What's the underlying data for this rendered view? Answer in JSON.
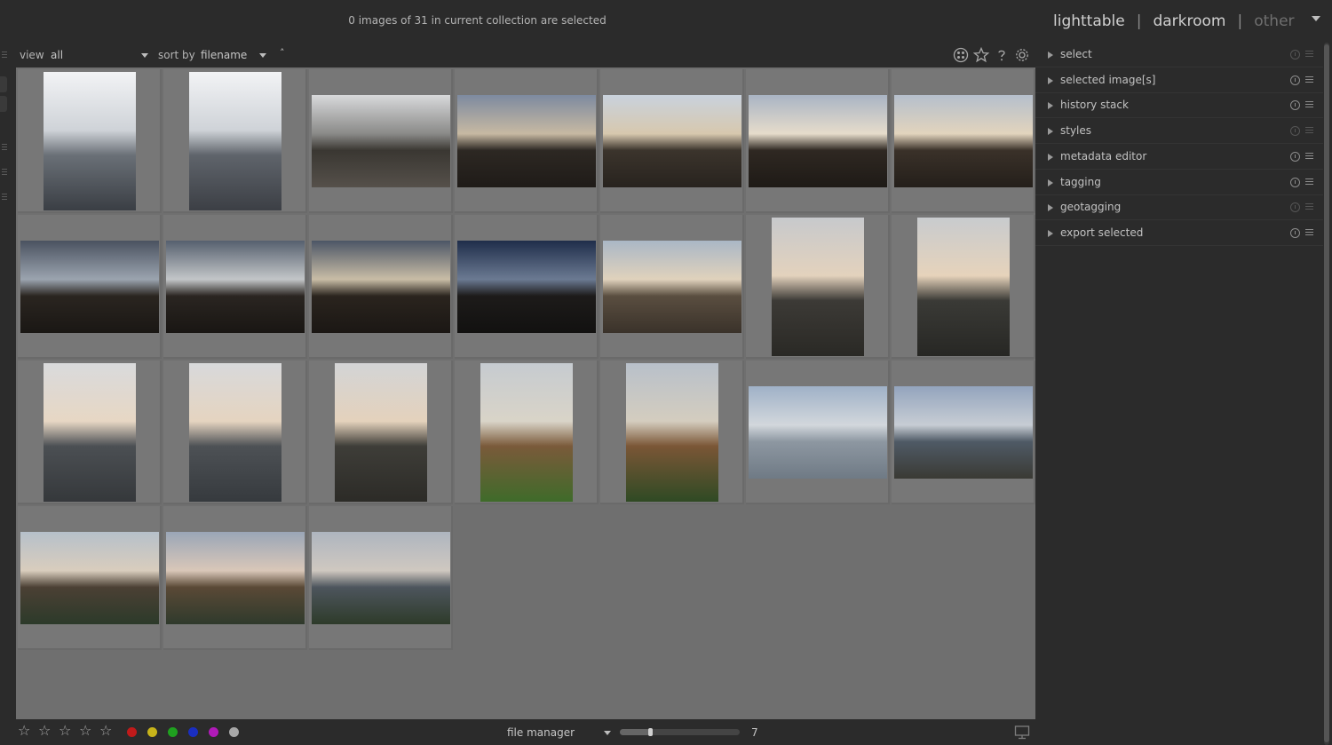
{
  "header": {
    "status": "0 images of 31 in current collection are selected",
    "views": [
      {
        "label": "lighttable",
        "active": true
      },
      {
        "label": "darkroom",
        "active": false
      },
      {
        "label": "other",
        "active": false
      }
    ]
  },
  "toolbar": {
    "view_label": "view",
    "view_value": "all",
    "sort_label": "sort by",
    "sort_value": "filename",
    "sort_order_glyph": "˄",
    "icons": [
      "grouping-icon",
      "star-overlay-icon",
      "help-icon",
      "preferences-gear-icon"
    ]
  },
  "grid": {
    "columns": 7,
    "thumbs_per_row": 7,
    "images": [
      {
        "orient": "portrait",
        "colors": [
          "#f2f3f5",
          "#cfd3d8",
          "#6a7077",
          "#3a3e44"
        ]
      },
      {
        "orient": "portrait",
        "colors": [
          "#f2f3f5",
          "#cfd3d8",
          "#5f646b",
          "#3c3f45"
        ]
      },
      {
        "orient": "landscape",
        "colors": [
          "#d8d9db",
          "#8a8a88",
          "#3a3732",
          "#55504a"
        ]
      },
      {
        "orient": "landscape",
        "colors": [
          "#7d8aa0",
          "#c7b9a2",
          "#2d2823",
          "#1f1b18"
        ]
      },
      {
        "orient": "landscape",
        "colors": [
          "#c9d2dd",
          "#d7c8ae",
          "#3b342c",
          "#28231e"
        ]
      },
      {
        "orient": "landscape",
        "colors": [
          "#a9b4c4",
          "#e6dccb",
          "#2f2822",
          "#1e1a16"
        ]
      },
      {
        "orient": "landscape",
        "colors": [
          "#b5bfcc",
          "#e2d4bd",
          "#3a3129",
          "#241f1a"
        ]
      },
      {
        "orient": "landscape",
        "colors": [
          "#4a5260",
          "#9ba4af",
          "#2a2520",
          "#1a1714"
        ]
      },
      {
        "orient": "landscape",
        "colors": [
          "#56606f",
          "#c3c6c8",
          "#2a2521",
          "#191613"
        ]
      },
      {
        "orient": "landscape",
        "colors": [
          "#4c5666",
          "#c9bda6",
          "#2a241e",
          "#1b1714"
        ]
      },
      {
        "orient": "landscape",
        "colors": [
          "#1f2d4a",
          "#6b7a92",
          "#1d1b1a",
          "#121110"
        ]
      },
      {
        "orient": "landscape",
        "colors": [
          "#aab7c6",
          "#e0d2bc",
          "#5a4e40",
          "#3a322a"
        ]
      },
      {
        "orient": "portrait",
        "colors": [
          "#c7c9cc",
          "#e3d2bd",
          "#3c3a36",
          "#2a2925"
        ]
      },
      {
        "orient": "portrait",
        "colors": [
          "#c8cbce",
          "#e6d3bb",
          "#3a3a36",
          "#272724"
        ]
      },
      {
        "orient": "portrait",
        "colors": [
          "#d9dadc",
          "#e7d7c4",
          "#4b4f53",
          "#35383b"
        ]
      },
      {
        "orient": "portrait",
        "colors": [
          "#d8d9db",
          "#e5d4c0",
          "#4d5155",
          "#363a3e"
        ]
      },
      {
        "orient": "portrait",
        "colors": [
          "#d3d4d6",
          "#e4d2bc",
          "#3e3d38",
          "#2c2b27"
        ]
      },
      {
        "orient": "portrait",
        "colors": [
          "#c6cbd0",
          "#d9d4c8",
          "#7a5a3a",
          "#3f6b2a"
        ]
      },
      {
        "orient": "portrait",
        "colors": [
          "#b8c0ca",
          "#d4cdbf",
          "#7a5636",
          "#2f4a24"
        ]
      },
      {
        "orient": "landscape",
        "colors": [
          "#9fb1c7",
          "#d2d7dc",
          "#8d97a1",
          "#6f7a85"
        ]
      },
      {
        "orient": "landscape",
        "colors": [
          "#93a4bd",
          "#c7cdd4",
          "#4f5a66",
          "#3a3a34"
        ]
      },
      {
        "orient": "landscape",
        "colors": [
          "#b6c0ca",
          "#d9cdbd",
          "#4b4034",
          "#2c3a2a"
        ]
      },
      {
        "orient": "landscape",
        "colors": [
          "#9aa6b7",
          "#d9c7b8",
          "#5a4936",
          "#2f3a2c"
        ]
      },
      {
        "orient": "landscape",
        "colors": [
          "#aeb5bf",
          "#cfc8c0",
          "#4d555d",
          "#2e3b2a"
        ]
      }
    ]
  },
  "modules": [
    {
      "label": "select",
      "active": false
    },
    {
      "label": "selected image[s]",
      "active": true
    },
    {
      "label": "history stack",
      "active": true
    },
    {
      "label": "styles",
      "active": false
    },
    {
      "label": "metadata editor",
      "active": true
    },
    {
      "label": "tagging",
      "active": true
    },
    {
      "label": "geotagging",
      "active": false
    },
    {
      "label": "export selected",
      "active": true
    }
  ],
  "bottom": {
    "star_glyph": "☆",
    "stars": 5,
    "color_labels": [
      "#c01a1a",
      "#c8b41a",
      "#1fa01f",
      "#1a2ec0",
      "#b01ab8",
      "#a8a8a8"
    ],
    "layout": "file manager",
    "zoom": 7,
    "zoom_fraction": 0.25,
    "display_icon": "display-icon"
  }
}
